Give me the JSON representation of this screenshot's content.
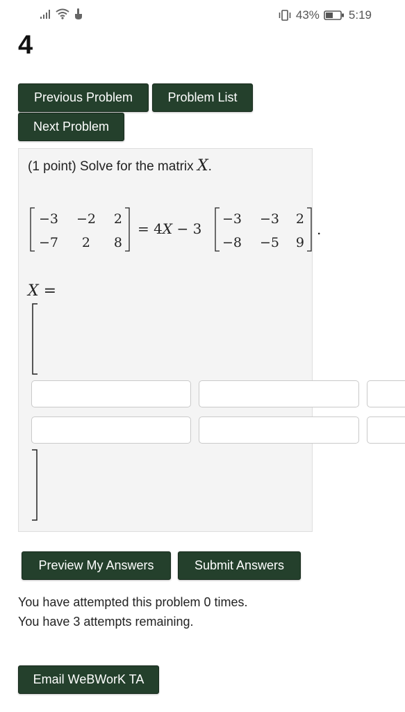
{
  "status_bar": {
    "battery_pct": "43%",
    "time": "5:19"
  },
  "problem": {
    "number": "4"
  },
  "nav": {
    "previous": "Previous Problem",
    "list": "Problem List",
    "next": "Next Problem"
  },
  "question": {
    "points": "(1 point)",
    "prompt": "Solve for the matrix",
    "variable": "X",
    "period": ".",
    "lhs_matrix": [
      [
        "−3",
        "−2",
        "2"
      ],
      [
        "−7",
        "2",
        "8"
      ]
    ],
    "equals": "= 4",
    "minus": "− 3",
    "rhs_matrix": [
      [
        "−3",
        "−3",
        "2"
      ],
      [
        "−8",
        "−5",
        "9"
      ]
    ],
    "answer_label": "X",
    "answer_equals": "="
  },
  "answer_inputs": [
    [
      "",
      "",
      ""
    ],
    [
      "",
      "",
      ""
    ]
  ],
  "actions": {
    "preview": "Preview My Answers",
    "submit": "Submit Answers"
  },
  "attempts": {
    "line1": "You have attempted this problem 0 times.",
    "line2": "You have 3 attempts remaining."
  },
  "email": {
    "label": "Email WeBWorK TA"
  }
}
